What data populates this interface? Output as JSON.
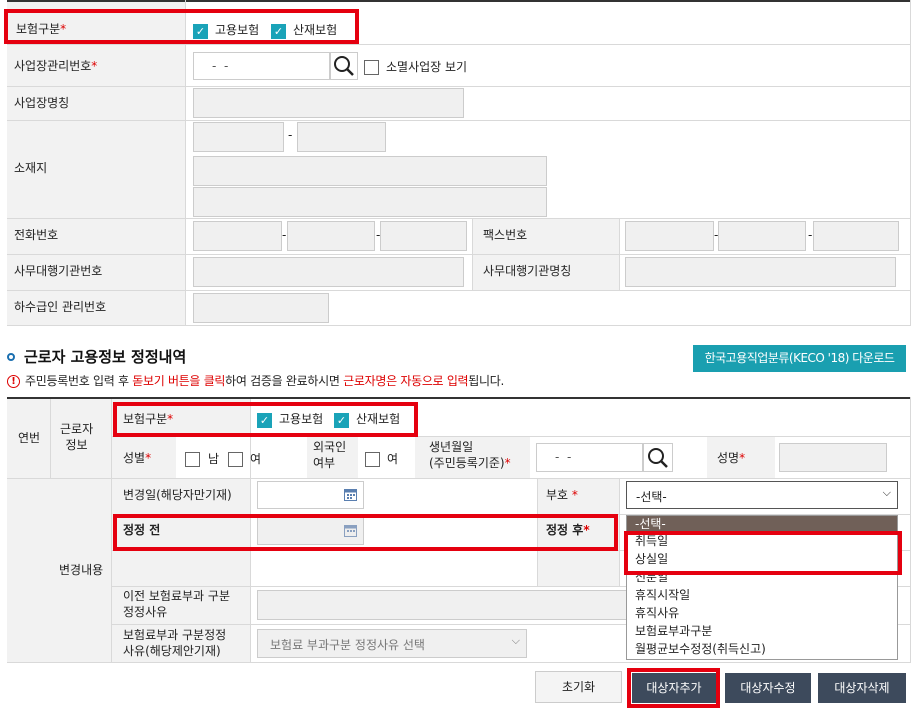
{
  "top": {
    "insurance_label": "보험구분",
    "required_mark": "*",
    "employment_insurance": "고용보험",
    "industrial_insurance": "산재보험",
    "workplace_no_label": "사업장관리번호",
    "workplace_no_value": "-  -",
    "closed_workplace_label": "소멸사업장 보기",
    "workplace_name_label": "사업장명칭",
    "address_label": "소재지",
    "address_dash": "-",
    "phone_label": "전화번호",
    "fax_label": "팩스번호",
    "dash": "-",
    "agency_no_label": "사무대행기관번호",
    "agency_name_label": "사무대행기관명칭",
    "subcontract_label": "하수급인 관리번호"
  },
  "section": {
    "title": "근로자 고용정보 정정내역",
    "keco_button": "한국고용직업분류(KECO '18) 다운로드",
    "notice_parts": [
      "주민등록번호 입력 후 ",
      "돋보기 버튼을 클릭",
      "하여 검증을 완료하시면 ",
      "근로자명은 자동으로 입력",
      "됩니다."
    ]
  },
  "worker": {
    "row_no_label": "연번",
    "worker_info_label": "근로자\n정보",
    "insurance_label": "보험구분",
    "employment_insurance": "고용보험",
    "industrial_insurance": "산재보험",
    "gender_label": "성별",
    "male": "남",
    "female": "여",
    "foreigner_label": "외국인\n여부",
    "foreigner_yes": "여",
    "birth_label": "생년월일\n(주민등록기준)",
    "birth_value": "-  -",
    "name_label": "성명",
    "change_content_label": "변경내용",
    "change_date_label": "변경일(해당자만기재)",
    "code_label": "부호",
    "code_select_value": "-선택-",
    "before_label": "정정 전",
    "after_label": "정정 후",
    "prev_reason_label": "이전 보험료부과 구분\n정정사유",
    "reason_label": "보험료부과 구분정정\n사유(해당제안기재)",
    "reason_select_value": "보험료 부과구분 정정사유 선택"
  },
  "dropdown": {
    "options": [
      "-선택-",
      "취득일",
      "상실일",
      "신분일",
      "휴직시작일",
      "휴직사유",
      "보험료부과구분",
      "월평균보수정정(취득신고)"
    ],
    "highlighted_index": 0
  },
  "buttons": {
    "reset": "초기화",
    "add": "대상자추가",
    "edit": "대상자수정",
    "delete": "대상자삭제"
  },
  "colors": {
    "teal_button": "#1a9fb0",
    "dark_button": "#3d4a5c",
    "highlight_red": "#e5000f",
    "checkbox_teal": "#1aa3b8"
  }
}
